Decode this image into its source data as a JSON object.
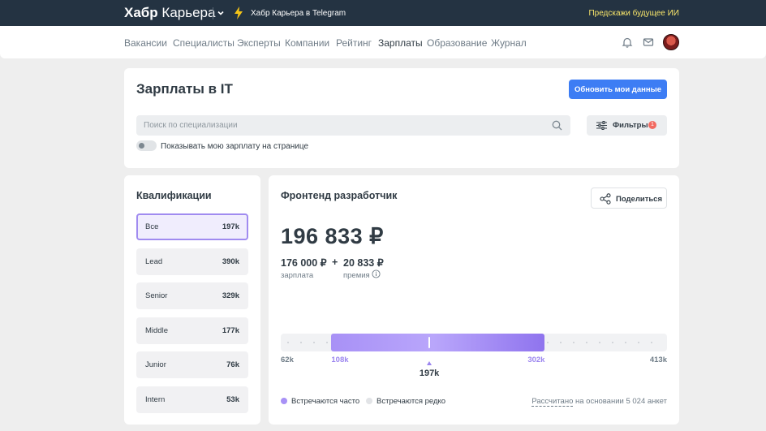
{
  "topbar": {
    "logo_bold": "Хабр",
    "logo_light": "Карьера",
    "telegram_link": "Хабр Карьера в Telegram",
    "promo": "Предскажи будущее ИИ"
  },
  "nav": {
    "items": [
      "Вакансии",
      "Специалисты",
      "Эксперты",
      "Компании",
      "Рейтинг",
      "Зарплаты",
      "Образование",
      "Журнал"
    ],
    "active": "Зарплаты"
  },
  "header": {
    "title": "Зарплаты в IT",
    "update_button": "Обновить мои данные",
    "search_placeholder": "Поиск по специализации",
    "filters_label": "Фильтры",
    "filters_count": "1",
    "toggle_label": "Показывать мою зарплату на странице",
    "toggle_on": false
  },
  "qualifications": {
    "title": "Квалификации",
    "selected": "Все",
    "items": [
      {
        "name": "Все",
        "value": "197k"
      },
      {
        "name": "Lead",
        "value": "390k"
      },
      {
        "name": "Senior",
        "value": "329k"
      },
      {
        "name": "Middle",
        "value": "177k"
      },
      {
        "name": "Junior",
        "value": "76k"
      },
      {
        "name": "Intern",
        "value": "53k"
      }
    ]
  },
  "salary": {
    "specialization": "Фронтенд разработчик",
    "share_label": "Поделиться",
    "total": "196 833 ₽",
    "salary_value": "176 000 ₽",
    "plus": "+",
    "bonus_value": "20 833 ₽",
    "salary_caption": "зарплата",
    "bonus_caption": "премия",
    "range": {
      "min": 62,
      "max": 413,
      "low": 108,
      "high": 302,
      "median": 197,
      "min_label": "62k",
      "max_label": "413k",
      "low_label": "108k",
      "high_label": "302k",
      "median_label": "197k"
    },
    "legend_often": "Встречаются часто",
    "legend_rarely": "Встречаются редко",
    "footnote_link": "Рассчитано",
    "footnote_rest": " на основании 5 024 анкет"
  },
  "colors": {
    "topbar": "#243342",
    "accent": "#3d7df4",
    "range": "#9b85ef",
    "promo": "#f7e46a"
  }
}
